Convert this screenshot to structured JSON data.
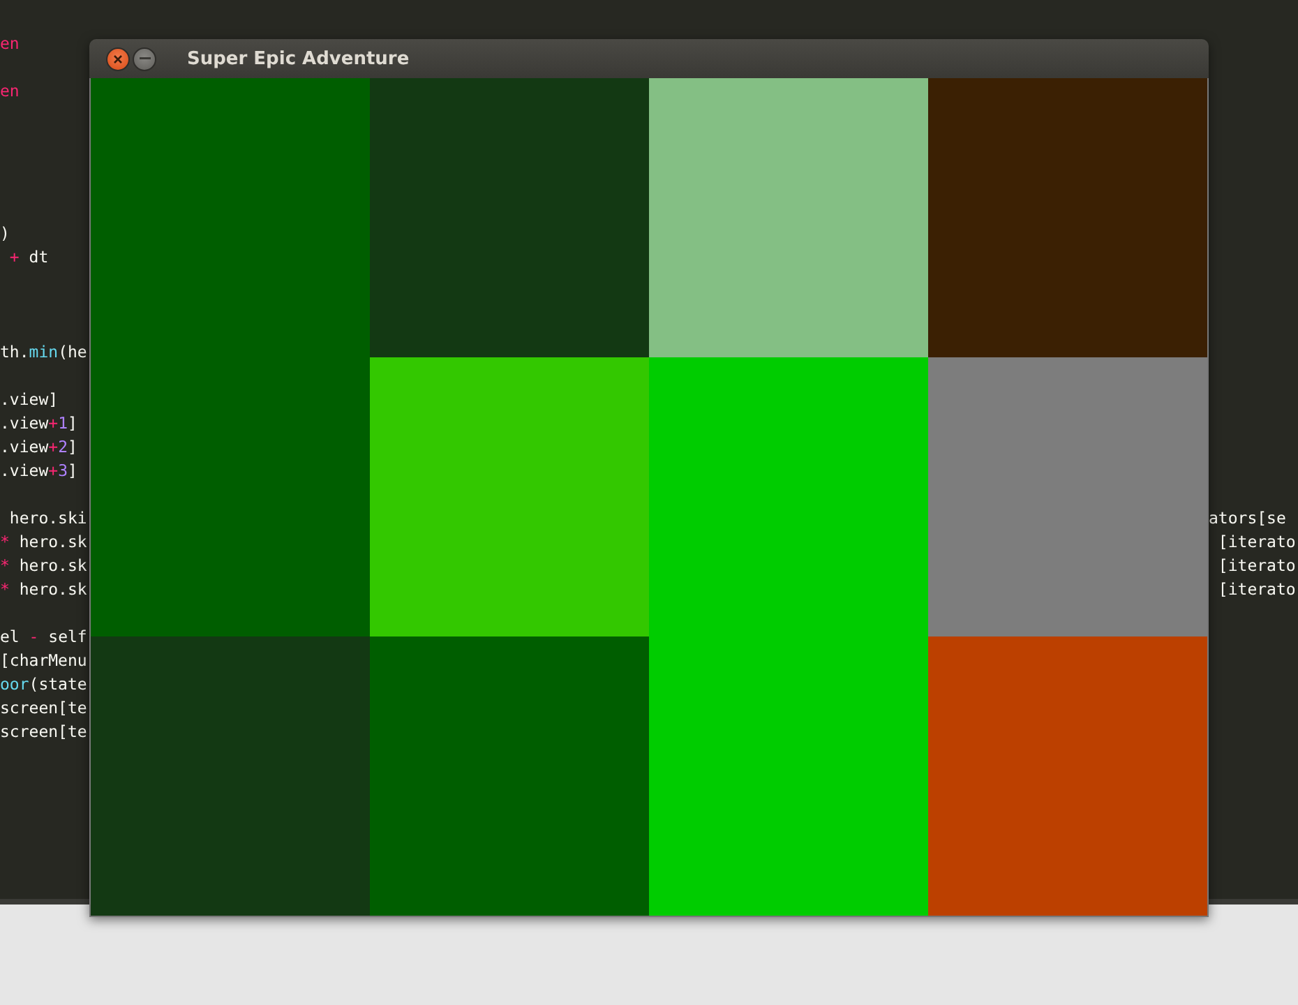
{
  "editor": {
    "lines": [
      {
        "left": [
          {
            "text": "en",
            "kind": "keyword"
          }
        ]
      },
      {
        "left": [
          {
            "text": "en",
            "kind": "keyword"
          }
        ]
      },
      {
        "left": [
          {
            "text": ")",
            "kind": "plain"
          }
        ]
      },
      {
        "left": [
          {
            "text": " + ",
            "kind": "keyword"
          },
          {
            "text": "dt",
            "kind": "plain"
          }
        ]
      },
      {
        "left": [
          {
            "text": "th.",
            "kind": "plain"
          },
          {
            "text": "min",
            "kind": "function"
          },
          {
            "text": "(he",
            "kind": "plain"
          }
        ]
      },
      {
        "left": [
          {
            "text": ".view]",
            "kind": "plain"
          }
        ]
      },
      {
        "left": [
          {
            "text": ".view",
            "kind": "plain"
          },
          {
            "text": "+",
            "kind": "keyword"
          },
          {
            "text": "1",
            "kind": "number"
          },
          {
            "text": "]",
            "kind": "plain"
          }
        ]
      },
      {
        "left": [
          {
            "text": ".view",
            "kind": "plain"
          },
          {
            "text": "+",
            "kind": "keyword"
          },
          {
            "text": "2",
            "kind": "number"
          },
          {
            "text": "]",
            "kind": "plain"
          }
        ]
      },
      {
        "left": [
          {
            "text": ".view",
            "kind": "plain"
          },
          {
            "text": "+",
            "kind": "keyword"
          },
          {
            "text": "3",
            "kind": "number"
          },
          {
            "text": "]",
            "kind": "plain"
          }
        ]
      },
      {
        "left": [
          {
            "text": " hero.ski",
            "kind": "plain"
          }
        ],
        "right": "ators[se"
      },
      {
        "left": [
          {
            "text": "* ",
            "kind": "keyword"
          },
          {
            "text": "hero.sk",
            "kind": "plain"
          }
        ],
        "right": " [iterato"
      },
      {
        "left": [
          {
            "text": "* ",
            "kind": "keyword"
          },
          {
            "text": "hero.sk",
            "kind": "plain"
          }
        ],
        "right": " [iterato"
      },
      {
        "left": [
          {
            "text": "* ",
            "kind": "keyword"
          },
          {
            "text": "hero.sk",
            "kind": "plain"
          }
        ],
        "right": " [iterato"
      },
      {
        "left": [
          {
            "text": "el ",
            "kind": "plain"
          },
          {
            "text": "-",
            "kind": "keyword"
          },
          {
            "text": " self",
            "kind": "plain"
          }
        ]
      },
      {
        "left": [
          {
            "text": "[charMenu",
            "kind": "plain"
          }
        ]
      },
      {
        "left": [
          {
            "text": "oor",
            "kind": "function"
          },
          {
            "text": "(state",
            "kind": "plain"
          }
        ]
      },
      {
        "left": [
          {
            "text": "screen[te",
            "kind": "plain"
          }
        ]
      },
      {
        "left": [
          {
            "text": "screen[te",
            "kind": "plain"
          }
        ]
      }
    ]
  },
  "window": {
    "title": "Super Epic Adventure",
    "tiles": [
      {
        "color": "#005e00"
      },
      {
        "color": "#133913"
      },
      {
        "color": "#84bf84"
      },
      {
        "color": "#3b2003"
      },
      {
        "color": "#005e00"
      },
      {
        "color": "#33c800"
      },
      {
        "color": "#00cc00"
      },
      {
        "color": "#7d7d7d"
      },
      {
        "color": "#133913"
      },
      {
        "color": "#005e00"
      },
      {
        "color": "#00cc00"
      },
      {
        "color": "#bc4000"
      }
    ]
  }
}
